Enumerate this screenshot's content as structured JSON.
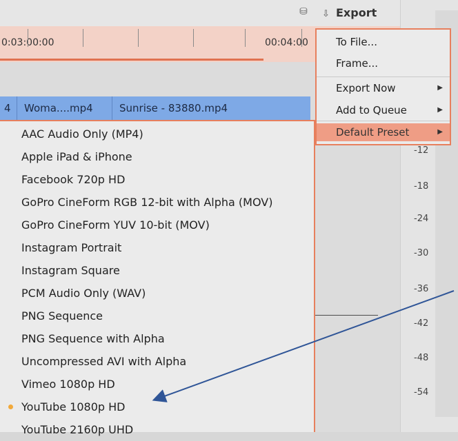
{
  "toolbar": {
    "export_label": "Export",
    "icons": [
      "database-icon",
      "export-icon"
    ]
  },
  "timeline": {
    "timecodes": [
      "0:03:00:00",
      "00:04:00"
    ]
  },
  "clips": [
    "4",
    "Woma....mp4",
    "Sunrise - 83880.mp4"
  ],
  "export_menu": {
    "items": [
      {
        "label": "To File...",
        "has_submenu": false
      },
      {
        "label": "Frame...",
        "has_submenu": false
      },
      {
        "label": "Export Now",
        "has_submenu": true
      },
      {
        "label": "Add to Queue",
        "has_submenu": true
      },
      {
        "label": "Default Preset",
        "has_submenu": true,
        "highlighted": true
      }
    ]
  },
  "preset_menu": {
    "items": [
      {
        "label": "AAC Audio Only (MP4)"
      },
      {
        "label": "Apple iPad & iPhone"
      },
      {
        "label": "Facebook 720p HD"
      },
      {
        "label": "GoPro CineForm RGB 12-bit with Alpha (MOV)"
      },
      {
        "label": "GoPro CineForm YUV 10-bit (MOV)"
      },
      {
        "label": "Instagram Portrait"
      },
      {
        "label": "Instagram Square"
      },
      {
        "label": "PCM Audio Only (WAV)"
      },
      {
        "label": "PNG Sequence"
      },
      {
        "label": "PNG Sequence with Alpha"
      },
      {
        "label": "Uncompressed AVI with Alpha"
      },
      {
        "label": "Vimeo 1080p HD"
      },
      {
        "label": "YouTube 1080p HD",
        "selected": true
      },
      {
        "label": "YouTube 2160p UHD"
      }
    ]
  },
  "audio_meter_scale": [
    "-12",
    "-18",
    "-24",
    "-30",
    "-36",
    "-42",
    "-48",
    "-54"
  ],
  "colors": {
    "accent": "#e77f5d",
    "highlight": "#ef9d85",
    "clip": "#7ea9e6",
    "selected_dot": "#f2a93b",
    "annotation_arrow": "#2f5597"
  }
}
